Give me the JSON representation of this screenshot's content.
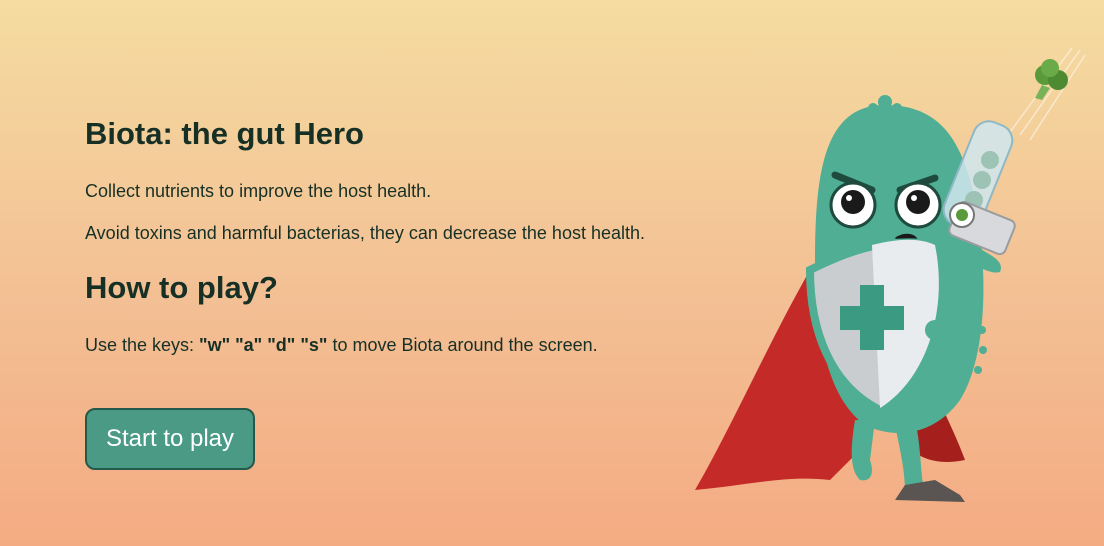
{
  "game": {
    "title": "Biota: the gut Hero",
    "intro_line_1": "Collect nutrients to improve the host health.",
    "intro_line_2": "Avoid toxins and harmful bacterias, they can decrease the host health.",
    "how_to_title": "How to play?",
    "keys_prefix": "Use the keys: ",
    "keys": [
      "\"w\"",
      "\"a\"",
      "\"d\"",
      "\"s\""
    ],
    "keys_suffix": " to move Biota around the screen.",
    "start_button_label": "Start to play"
  },
  "hero": {
    "name": "biota-hero-illustration",
    "colors": {
      "body": "#4fae94",
      "cape": "#c42a27",
      "shield": "#c9cdd0",
      "cross": "#3a9a82",
      "broccoli": "#5a9a3a"
    }
  },
  "colors": {
    "text": "#173026",
    "button_bg": "#4a9a86",
    "button_border": "#245a4b",
    "button_text": "#ffffff"
  }
}
